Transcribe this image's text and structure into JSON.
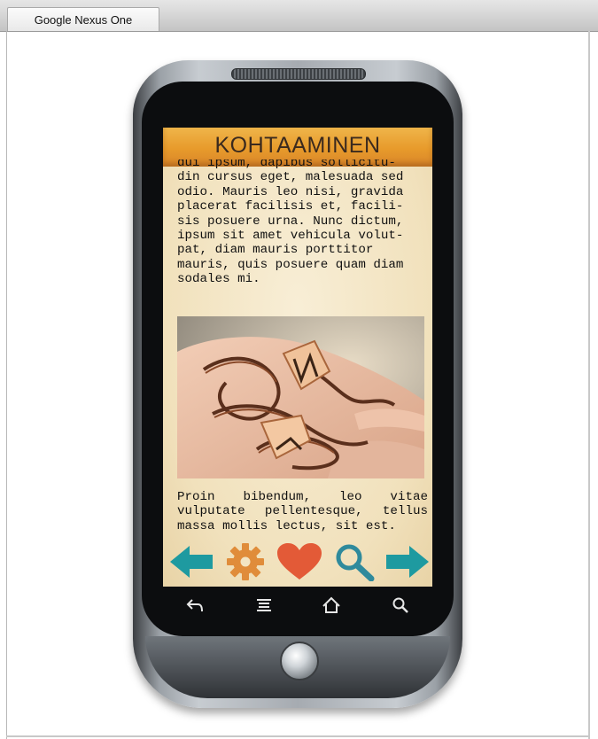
{
  "window": {
    "tab_label": "Google Nexus One"
  },
  "app": {
    "header_title": "KOHTAAMINEN",
    "article_lines_top": [
      "dui ipsum, dapibus sollicitu-",
      "din cursus eget, malesuada sed",
      "odio. Mauris leo nisi, gravida",
      "placerat facilisis et, facili-",
      "sis posuere urna. Nunc dictum,",
      "ipsum sit amet vehicula volut-",
      "pat, diam mauris porttitor",
      "mauris, quis posuere quam diam",
      "sodales mi."
    ],
    "article_bottom": "Proin bibendum, leo vitae vulputate pellentesque, tellus massa mollis lectus, sit est.",
    "toolbar": {
      "colors": {
        "back": "#1e9aa0",
        "settings": "#e08c3a",
        "like": "#e35a37",
        "search": "#2f8a9c",
        "forward": "#1e9aa0"
      },
      "icons": [
        "arrow-left-icon",
        "gear-icon",
        "heart-icon",
        "search-icon",
        "arrow-right-icon"
      ]
    }
  },
  "device_nav": {
    "icons": [
      "back-icon",
      "menu-icon",
      "home-icon",
      "search-icon"
    ]
  }
}
